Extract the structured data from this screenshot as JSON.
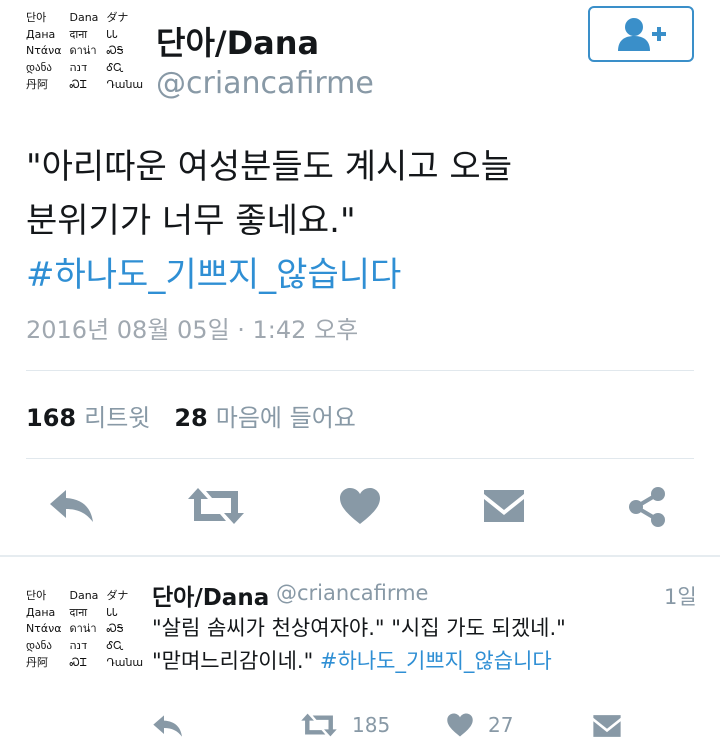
{
  "tweet": {
    "avatar_lines": [
      [
        "단아",
        "Dana",
        "ダナ"
      ],
      [
        "Дана",
        "दाना",
        "ᏓᏓ"
      ],
      [
        "Ντάνα",
        "ดาน่า",
        "ᏍᎦ"
      ],
      [
        "დანა",
        "דנה",
        "ᎴᏩ"
      ],
      [
        "丹阿",
        "ᏍᏆ",
        "Դանա"
      ]
    ],
    "name": "단아/Dana",
    "handle": "@criancafirme",
    "text_line1": "\"아리따운 여성분들도 계시고 오늘",
    "text_line2": "분위기가 너무 좋네요.\"",
    "hashtag": "#하나도_기쁘지_않습니다",
    "timestamp": "2016년 08월 05일 · 1:42 오후",
    "retweet_count": "168",
    "retweet_label": "리트윗",
    "like_count": "28",
    "like_label": "마음에 들어요",
    "actions": {
      "reply_icon": "reply-icon",
      "retweet_icon": "retweet-icon",
      "like_icon": "heart-icon",
      "dm_icon": "envelope-icon",
      "share_icon": "share-icon"
    },
    "accent_color": "#2f8fd4",
    "icon_color": "#8899a6"
  },
  "reply": {
    "avatar_lines": [
      [
        "단아",
        "Dana",
        "ダナ"
      ],
      [
        "Дана",
        "दाना",
        "ᏓᏓ"
      ],
      [
        "Ντάνα",
        "ดาน่า",
        "ᏍᎦ"
      ],
      [
        "დანა",
        "דנה",
        "ᎴᏩ"
      ],
      [
        "丹阿",
        "ᏍᏆ",
        "Դանա"
      ]
    ],
    "name": "단아/Dana",
    "handle": "@criancafirme",
    "age": "1일",
    "text_line1": "\"살림 솜씨가 천상여자야.\" \"시집 가도 되겠네.\"",
    "text_line2_plain": "\"맏며느리감이네.\"",
    "hashtag": "#하나도_기쁘지_않습니다",
    "retweet_count": "185",
    "like_count": "27"
  }
}
